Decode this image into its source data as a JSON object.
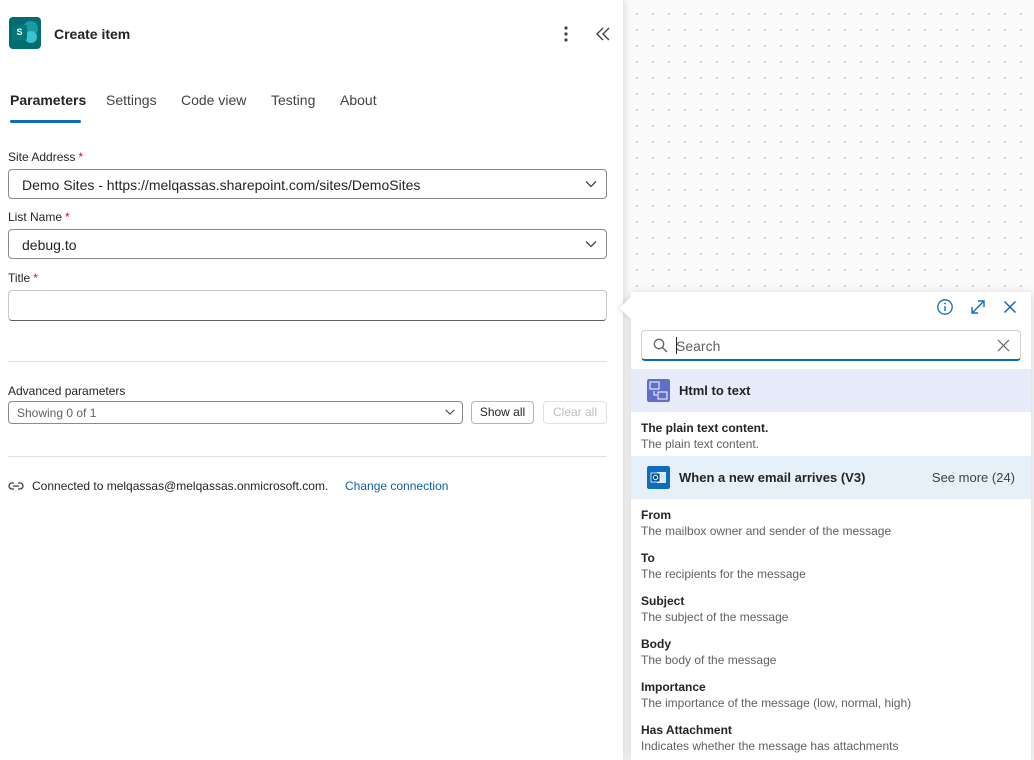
{
  "header": {
    "title": "Create item",
    "app_icon_letter": "S"
  },
  "tabs": [
    {
      "label": "Parameters",
      "active": true
    },
    {
      "label": "Settings"
    },
    {
      "label": "Code view"
    },
    {
      "label": "Testing"
    },
    {
      "label": "About"
    }
  ],
  "fields": {
    "site_address": {
      "label": "Site Address",
      "required": "*",
      "value": "Demo Sites - https://melqassas.sharepoint.com/sites/DemoSites"
    },
    "list_name": {
      "label": "List Name",
      "required": "*",
      "value": "debug.to"
    },
    "title": {
      "label": "Title",
      "required": "*",
      "value": ""
    }
  },
  "advanced": {
    "label": "Advanced parameters",
    "value": "Showing 0 of 1",
    "show_all": "Show all",
    "clear_all": "Clear all"
  },
  "connection": {
    "text": "Connected to melqassas@melqassas.onmicrosoft.com.",
    "change_link": "Change connection"
  },
  "popup": {
    "search": {
      "placeholder": "Search",
      "value": ""
    },
    "groups": [
      {
        "title": "Html to text",
        "items": [
          {
            "title": "The plain text content.",
            "desc": "The plain text content."
          }
        ]
      },
      {
        "title": "When a new email arrives (V3)",
        "see_more": "See more (24)",
        "items": [
          {
            "title": "From",
            "desc": "The mailbox owner and sender of the message"
          },
          {
            "title": "To",
            "desc": "The recipients for the message"
          },
          {
            "title": "Subject",
            "desc": "The subject of the message"
          },
          {
            "title": "Body",
            "desc": "The body of the message"
          },
          {
            "title": "Importance",
            "desc": "The importance of the message (low, normal, high)"
          },
          {
            "title": "Has Attachment",
            "desc": "Indicates whether the message has attachments"
          }
        ]
      }
    ]
  },
  "colors": {
    "accent": "#0f6cbd",
    "required": "#c50f1f",
    "link": "#115ea3",
    "html_group_bg": "#e8ebfa",
    "email_group_bg": "#e6f0f8"
  }
}
